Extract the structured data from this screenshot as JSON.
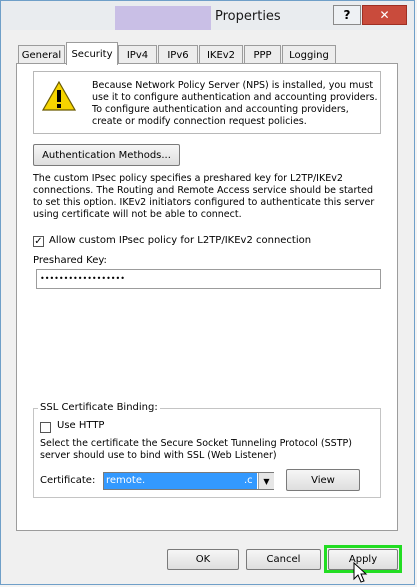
{
  "window": {
    "title": "Properties",
    "help_label": "?",
    "close_label": "✕"
  },
  "tabs": [
    {
      "label": "General",
      "active": false
    },
    {
      "label": "Security",
      "active": true
    },
    {
      "label": "IPv4",
      "active": false
    },
    {
      "label": "IPv6",
      "active": false
    },
    {
      "label": "IKEv2",
      "active": false
    },
    {
      "label": "PPP",
      "active": false
    },
    {
      "label": "Logging",
      "active": false
    }
  ],
  "security": {
    "warning_icon": "warning-triangle-icon",
    "warning_text": "Because Network Policy Server (NPS) is installed, you must use it to configure authentication and accounting providers. To configure authentication and accounting providers, create or modify connection request policies.",
    "auth_methods_button": "Authentication Methods...",
    "policy_text": "The custom IPsec policy specifies a preshared key for L2TP/IKEv2 connections. The Routing and Remote Access service should be started to set this option. IKEv2 initiators configured to authenticate this server using certificate will not be able to connect.",
    "allow_custom_policy": {
      "label": "Allow custom IPsec policy for L2TP/IKEv2 connection",
      "checked": true,
      "mark": "✓"
    },
    "preshared_key_label": "Preshared Key:",
    "preshared_key_value": "••••••••••••••••••"
  },
  "ssl": {
    "legend": "SSL Certificate Binding:",
    "use_http": {
      "label": "Use HTTP",
      "checked": false
    },
    "description": "Select the certificate the Secure Socket Tunneling Protocol (SSTP) server should use to bind with SSL (Web Listener)",
    "certificate_label": "Certificate:",
    "certificate_value": "remote.",
    "certificate_value_end": ".c",
    "dropdown_arrow": "▼",
    "view_button": "View"
  },
  "footer": {
    "ok": "OK",
    "cancel": "Cancel",
    "apply": "Apply"
  },
  "colors": {
    "highlight": "#22dd22",
    "selection": "#3399ff",
    "close_button": "#c94b3c"
  }
}
